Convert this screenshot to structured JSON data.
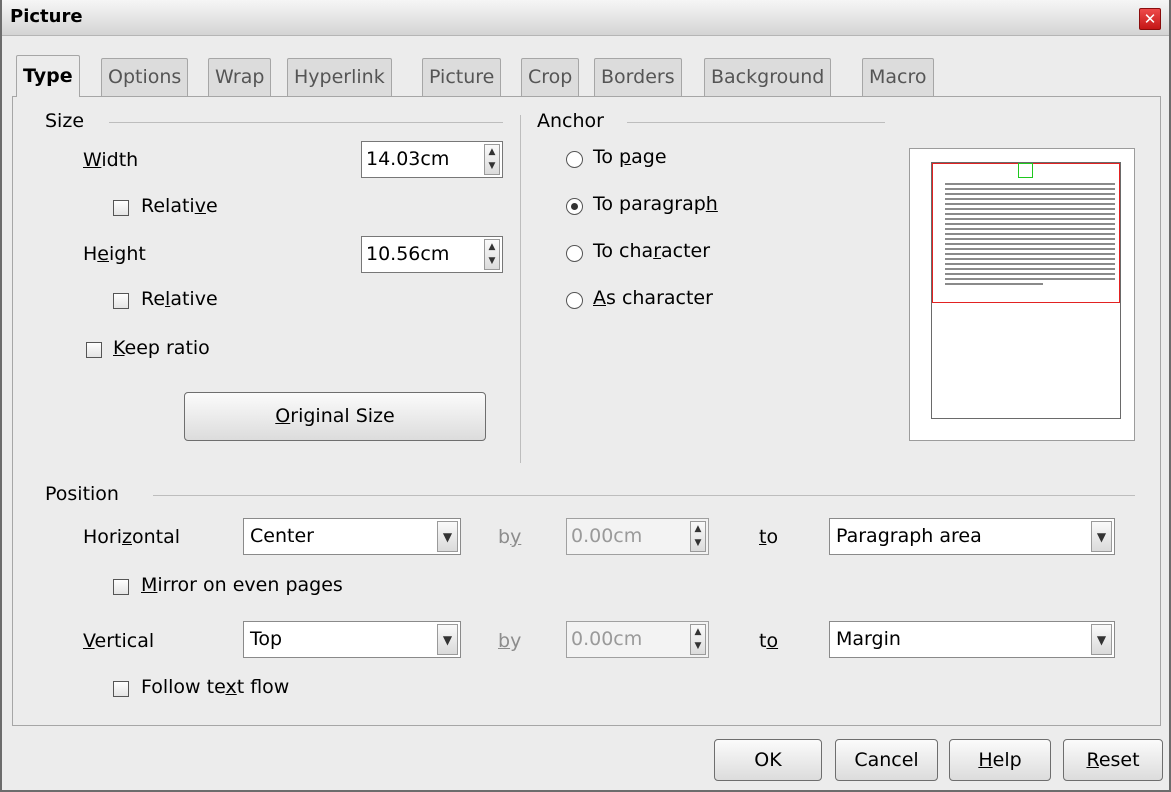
{
  "window": {
    "title": "Picture",
    "close_glyph": "✕"
  },
  "tabs": [
    "Type",
    "Options",
    "Wrap",
    "Hyperlink",
    "Picture",
    "Crop",
    "Borders",
    "Background",
    "Macro"
  ],
  "size": {
    "section": "Size",
    "width_label": "Width",
    "width_value": "14.03cm",
    "width_relative": "Relative",
    "height_label": "Height",
    "height_value": "10.56cm",
    "height_relative": "Relative",
    "keep_ratio": "Keep ratio",
    "original_size": "Original Size"
  },
  "anchor": {
    "section": "Anchor",
    "options": [
      "To page",
      "To paragraph",
      "To character",
      "As character"
    ],
    "selected": "To paragraph"
  },
  "position": {
    "section": "Position",
    "horizontal_label": "Horizontal",
    "horizontal_value": "Center",
    "h_by_label": "by",
    "h_by_value": "0.00cm",
    "h_to_label": "to",
    "h_to_value": "Paragraph area",
    "mirror": "Mirror on even pages",
    "vertical_label": "Vertical",
    "vertical_value": "Top",
    "v_by_label": "by",
    "v_by_value": "0.00cm",
    "v_to_label": "to",
    "v_to_value": "Margin",
    "follow": "Follow text flow"
  },
  "buttons": {
    "ok": "OK",
    "cancel": "Cancel",
    "help": "Help",
    "reset": "Reset"
  },
  "icons": {
    "spin": "spin-arrows-icon",
    "dropdown": "chevron-down-icon"
  }
}
